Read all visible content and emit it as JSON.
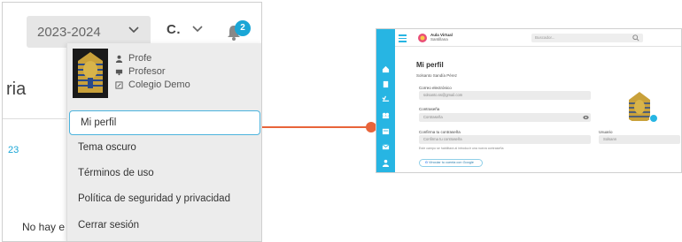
{
  "left_panel": {
    "year_select": {
      "value": "2023-2024"
    },
    "class_select": {
      "value": "C."
    },
    "notifications": {
      "count": "2"
    },
    "background_text": {
      "heading_fragment": "ria",
      "link_fragment": "23",
      "empty_fragment": "No hay e"
    },
    "dropdown": {
      "profile": {
        "name": "Profe",
        "role": "Profesor",
        "school": "Colegio Demo"
      },
      "items": [
        {
          "label": "Mi perfil"
        },
        {
          "label": "Tema oscuro"
        },
        {
          "label": "Términos de uso"
        },
        {
          "label": "Política de seguridad y privacidad"
        },
        {
          "label": "Cerrar sesión"
        }
      ]
    }
  },
  "right_panel": {
    "brand": {
      "line1": "Aula Virtual",
      "line2": "Santillana"
    },
    "search": {
      "placeholder": "Buscador..."
    },
    "page_title": "Mi perfil",
    "user_full_name": "Solsanto Sandía Pérez",
    "email": {
      "label": "Correo electrónico",
      "value": "solsanto.ss@gmail.com"
    },
    "password": {
      "label": "Contraseña",
      "value": "Contraseña"
    },
    "confirm_password": {
      "label": "Confirma tu contraseña",
      "value": "Confirma tu contraseña"
    },
    "username": {
      "label": "Usuario",
      "value": "Solsann"
    },
    "hint": "Este campo se habilitará al introducir una nueva contraseña",
    "google_button": "Vincular tu cuenta con Google"
  },
  "colors": {
    "accent": "#27b5e3",
    "connector": "#e8643a",
    "badge": "#1aa6d6"
  }
}
